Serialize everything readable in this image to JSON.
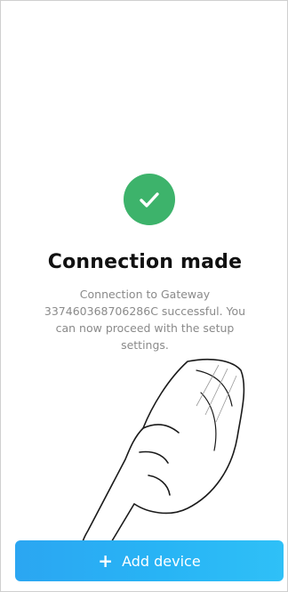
{
  "screen": {
    "title": "Connection made",
    "message": "Connection to Gateway 337460368706286C successful. You can now proceed with the setup settings.",
    "success_icon": "check-icon",
    "accent_color": "#3db36b"
  },
  "actions": {
    "add_device": {
      "icon": "plus-icon",
      "icon_glyph": "+",
      "label": "Add device",
      "color": "#29aff4"
    }
  }
}
